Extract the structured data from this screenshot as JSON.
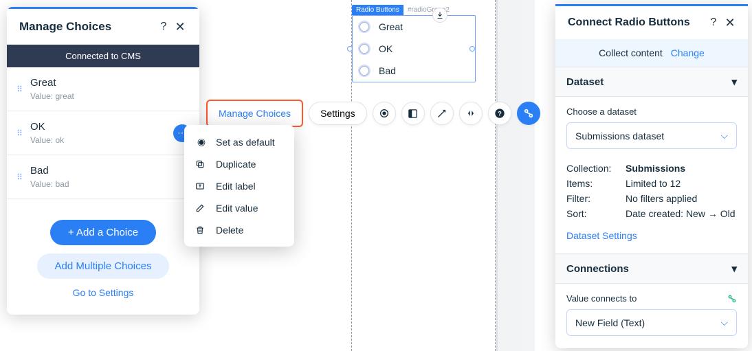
{
  "left": {
    "title": "Manage Choices",
    "cms_bar": "Connected to CMS",
    "choices": [
      {
        "label": "Great",
        "value_line": "Value: great"
      },
      {
        "label": "OK",
        "value_line": "Value: ok"
      },
      {
        "label": "Bad",
        "value_line": "Value: bad"
      }
    ],
    "add_choice": "+ Add a Choice",
    "add_multi": "Add Multiple Choices",
    "settings_link": "Go to Settings"
  },
  "ctx": {
    "set_default": "Set as default",
    "duplicate": "Duplicate",
    "edit_label": "Edit label",
    "edit_value": "Edit value",
    "delete": "Delete"
  },
  "canvas": {
    "widget_tag": "Radio Buttons",
    "widget_id": "#radioGroup2",
    "options": [
      "Great",
      "OK",
      "Bad"
    ]
  },
  "toolbar": {
    "manage": "Manage Choices",
    "settings": "Settings"
  },
  "right": {
    "title": "Connect Radio Buttons",
    "collect": "Collect content",
    "change": "Change",
    "dataset_section": "Dataset",
    "choose_label": "Choose a dataset",
    "dataset_value": "Submissions dataset",
    "kv": {
      "collection_k": "Collection:",
      "collection_v": "Submissions",
      "items_k": "Items:",
      "items_v": "Limited to 12",
      "filter_k": "Filter:",
      "filter_v": "No filters applied",
      "sort_k": "Sort:",
      "sort_v": "Date created: New → Old"
    },
    "ds_settings": "Dataset Settings",
    "connections_section": "Connections",
    "value_connects": "Value connects to",
    "field_value": "New Field (Text)"
  }
}
